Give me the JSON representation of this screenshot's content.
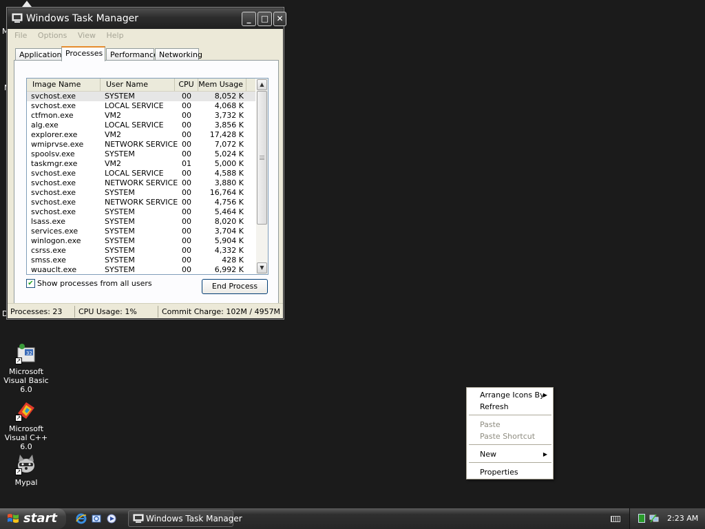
{
  "window": {
    "title": "Windows Task Manager",
    "controls": {
      "minimize": "_",
      "maximize": "□",
      "close": "✕"
    },
    "menu": [
      "File",
      "Options",
      "View",
      "Help"
    ],
    "tabs": [
      "Applications",
      "Processes",
      "Performance",
      "Networking"
    ],
    "active_tab": "Processes",
    "columns": [
      "Image Name",
      "User Name",
      "CPU",
      "Mem Usage"
    ],
    "processes": [
      [
        "svchost.exe",
        "SYSTEM",
        "00",
        "8,052 K"
      ],
      [
        "svchost.exe",
        "LOCAL SERVICE",
        "00",
        "4,068 K"
      ],
      [
        "ctfmon.exe",
        "VM2",
        "00",
        "3,732 K"
      ],
      [
        "alg.exe",
        "LOCAL SERVICE",
        "00",
        "3,856 K"
      ],
      [
        "explorer.exe",
        "VM2",
        "00",
        "17,428 K"
      ],
      [
        "wmiprvse.exe",
        "NETWORK SERVICE",
        "00",
        "7,072 K"
      ],
      [
        "spoolsv.exe",
        "SYSTEM",
        "00",
        "5,024 K"
      ],
      [
        "taskmgr.exe",
        "VM2",
        "01",
        "5,000 K"
      ],
      [
        "svchost.exe",
        "LOCAL SERVICE",
        "00",
        "4,588 K"
      ],
      [
        "svchost.exe",
        "NETWORK SERVICE",
        "00",
        "3,880 K"
      ],
      [
        "svchost.exe",
        "SYSTEM",
        "00",
        "16,764 K"
      ],
      [
        "svchost.exe",
        "NETWORK SERVICE",
        "00",
        "4,756 K"
      ],
      [
        "svchost.exe",
        "SYSTEM",
        "00",
        "5,464 K"
      ],
      [
        "lsass.exe",
        "SYSTEM",
        "00",
        "8,020 K"
      ],
      [
        "services.exe",
        "SYSTEM",
        "00",
        "3,704 K"
      ],
      [
        "winlogon.exe",
        "SYSTEM",
        "00",
        "5,904 K"
      ],
      [
        "csrss.exe",
        "SYSTEM",
        "00",
        "4,332 K"
      ],
      [
        "smss.exe",
        "SYSTEM",
        "00",
        "428 K"
      ],
      [
        "wuauclt.exe",
        "SYSTEM",
        "00",
        "6,992 K"
      ]
    ],
    "show_all_users_label": "Show processes from all users",
    "show_all_users_checked": "✔",
    "end_process_label": "End Process",
    "status": {
      "processes": "Processes: 23",
      "cpu": "CPU Usage: 1%",
      "commit": "Commit Charge: 102M / 4957M"
    }
  },
  "desktop": {
    "edge_letters": [
      "M",
      "M",
      "D"
    ],
    "icons": [
      {
        "label": "Microsoft Visual Basic 6.0",
        "icon": "vb6-icon"
      },
      {
        "label": "Microsoft Visual C++ 6.0",
        "icon": "vc6-icon"
      },
      {
        "label": "Mypal",
        "icon": "mypal-raccoon-icon"
      }
    ]
  },
  "context_menu": {
    "items": [
      {
        "label": "Arrange Icons By",
        "submenu": true,
        "disabled": false
      },
      {
        "label": "Refresh",
        "submenu": false,
        "disabled": false
      },
      {
        "label": "Paste",
        "submenu": false,
        "disabled": true
      },
      {
        "label": "Paste Shortcut",
        "submenu": false,
        "disabled": true
      },
      {
        "label": "New",
        "submenu": true,
        "disabled": false
      },
      {
        "label": "Properties",
        "submenu": false,
        "disabled": false
      }
    ]
  },
  "taskbar": {
    "start_label": "start",
    "task_button_label": "Windows Task Manager",
    "clock": "2:23 AM",
    "quick_launch": [
      "internet-explorer-icon",
      "outlook-express-icon",
      "media-player-icon"
    ]
  }
}
